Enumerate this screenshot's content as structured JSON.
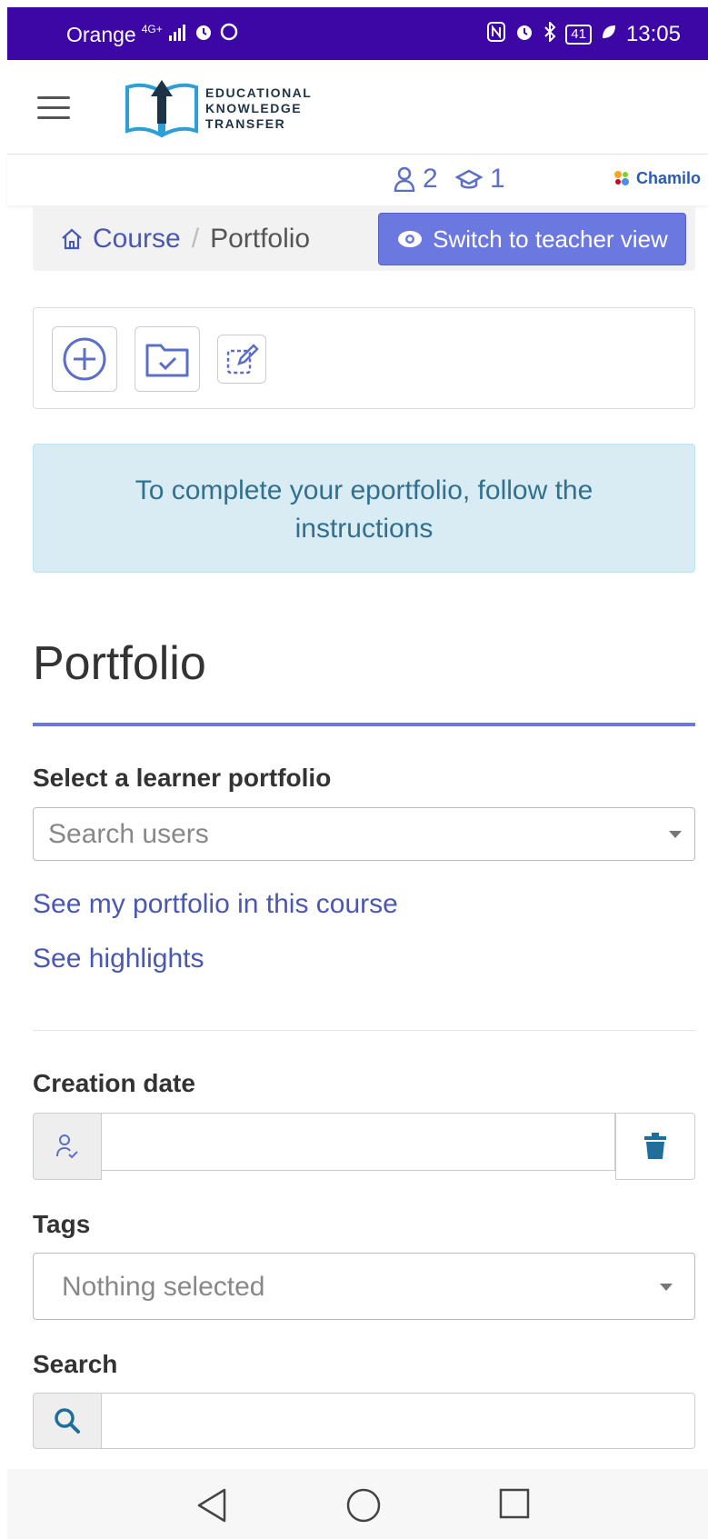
{
  "status_bar": {
    "carrier": "Orange",
    "network": "4G+",
    "time": "13:05",
    "battery": "41"
  },
  "header": {
    "logo_line1": "EDUCATIONAL",
    "logo_line2": "KNOWLEDGE",
    "logo_line3": "TRANSFER"
  },
  "subbar": {
    "users_count": "2",
    "courses_count": "1",
    "brand": "Chamilo"
  },
  "breadcrumb": {
    "course": "Course",
    "separator": "/",
    "current": "Portfolio"
  },
  "switch_button": "Switch to teacher view",
  "alert_text": "To complete your eportfolio, follow the instructions",
  "page_title": "Portfolio",
  "learner_select": {
    "label": "Select a learner portfolio",
    "placeholder": "Search users"
  },
  "links": {
    "my_portfolio": "See my portfolio in this course",
    "highlights": "See highlights"
  },
  "creation_date": {
    "label": "Creation date",
    "value": ""
  },
  "tags": {
    "label": "Tags",
    "placeholder": "Nothing selected"
  },
  "search": {
    "label": "Search",
    "value": ""
  },
  "colors": {
    "status_bar": "#3c07a5",
    "primary": "#6b78e0",
    "link": "#4a58b1",
    "alert_bg": "#d9ecf4",
    "alert_text": "#31708f",
    "trash": "#1f6f9a"
  }
}
